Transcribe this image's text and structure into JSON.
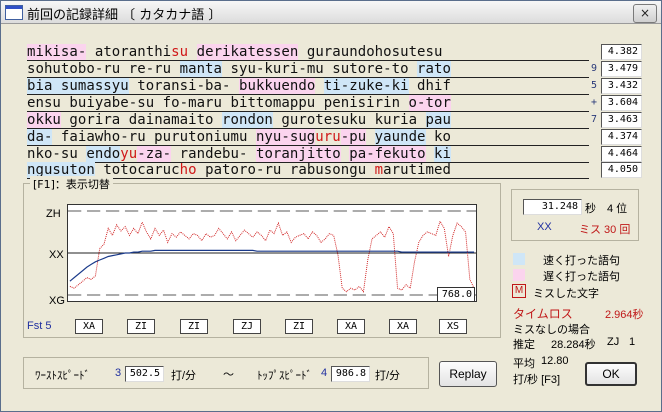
{
  "window": {
    "title": "前回の記録詳細 〔 カタカナ語 〕",
    "close_label": "×"
  },
  "text_lines": [
    {
      "mark": "",
      "speed": "4.382",
      "segments": [
        {
          "t": "mikisa-",
          "c": "slow"
        },
        {
          "t": " atoranthi",
          "c": ""
        },
        {
          "t": "su",
          "c": "miss"
        },
        {
          "t": " ",
          "c": ""
        },
        {
          "t": "derikatessen",
          "c": "slow"
        },
        {
          "t": " guraundohosutesu",
          "c": ""
        }
      ]
    },
    {
      "mark": "9",
      "speed": "3.479",
      "segments": [
        {
          "t": "sohutobo-ru re-ru ",
          "c": ""
        },
        {
          "t": "manta",
          "c": "fast"
        },
        {
          "t": " syu-kuri-mu sutore-to ",
          "c": ""
        },
        {
          "t": "rato",
          "c": "fast"
        }
      ]
    },
    {
      "mark": "5",
      "speed": "3.432",
      "segments": [
        {
          "t": "bia sumassyu",
          "c": "fast"
        },
        {
          "t": " toransi-ba- ",
          "c": ""
        },
        {
          "t": "bukkuendo",
          "c": "slow"
        },
        {
          "t": " ",
          "c": ""
        },
        {
          "t": "ti-zuke-ki",
          "c": "fast"
        },
        {
          "t": " dhif",
          "c": ""
        }
      ]
    },
    {
      "mark": "+",
      "speed": "3.604",
      "segments": [
        {
          "t": "ensu buiyabe-su fo-maru bittomappu penisirin ",
          "c": ""
        },
        {
          "t": "o-tor",
          "c": "slow"
        }
      ]
    },
    {
      "mark": "7",
      "speed": "3.463",
      "segments": [
        {
          "t": "okku",
          "c": "slow"
        },
        {
          "t": " gorira dainamaito ",
          "c": ""
        },
        {
          "t": "rondon",
          "c": "fast"
        },
        {
          "t": " gurotesuku kuria ",
          "c": ""
        },
        {
          "t": "pau",
          "c": "fast"
        }
      ]
    },
    {
      "mark": "",
      "speed": "4.374",
      "segments": [
        {
          "t": "da-",
          "c": "fast"
        },
        {
          "t": " faiawho-ru purutoniumu ",
          "c": ""
        },
        {
          "t": "nyu-sug",
          "c": "slow"
        },
        {
          "t": "uru",
          "c": "miss"
        },
        {
          "t": "-pu",
          "c": "slow"
        },
        {
          "t": " ",
          "c": ""
        },
        {
          "t": "yaunde",
          "c": "fast"
        },
        {
          "t": " ko",
          "c": ""
        }
      ]
    },
    {
      "mark": "",
      "speed": "4.464",
      "segments": [
        {
          "t": "nko-su ",
          "c": ""
        },
        {
          "t": "endo",
          "c": "fast"
        },
        {
          "t": "yu",
          "c": "miss"
        },
        {
          "t": "-za-",
          "c": "slow"
        },
        {
          "t": " randebu- ",
          "c": ""
        },
        {
          "t": "toranjitto",
          "c": "slow"
        },
        {
          "t": " ",
          "c": ""
        },
        {
          "t": "pa-fekuto",
          "c": "slow"
        },
        {
          "t": " ",
          "c": ""
        },
        {
          "t": "ki",
          "c": "fast"
        }
      ]
    },
    {
      "mark": "",
      "speed": "4.050",
      "segments": [
        {
          "t": "ngusuton",
          "c": "fast"
        },
        {
          "t": " totocaruc",
          "c": ""
        },
        {
          "t": "ho",
          "c": "miss"
        },
        {
          "t": " patoro-ru rabusongu ",
          "c": ""
        },
        {
          "t": "m",
          "c": "miss"
        },
        {
          "t": "arutimed",
          "c": ""
        }
      ]
    }
  ],
  "graph": {
    "group_label": "[F1]：表示切替",
    "y_top": "ZH",
    "y_mid": "XX",
    "y_bottom": "XG",
    "readout": "768.0",
    "fst_label": "Fst 5",
    "x_categories": [
      "XA",
      "ZI",
      "ZI",
      "ZJ",
      "ZI",
      "XA",
      "XA",
      "XS"
    ]
  },
  "chart_data": {
    "type": "line",
    "title": "",
    "y_tick_labels": [
      "ZH",
      "XX",
      "XG"
    ],
    "x_tick_labels": [
      "XA",
      "ZI",
      "ZI",
      "ZJ",
      "ZI",
      "XA",
      "XA",
      "XS"
    ],
    "series": [
      {
        "name": "",
        "color": "#d02020",
        "values": [
          0.12,
          0.1,
          0.14,
          0.18,
          0.22,
          0.2,
          0.24,
          0.55,
          0.6,
          0.78,
          0.7,
          0.82,
          0.75,
          0.8,
          0.7,
          0.78,
          0.72,
          0.85,
          0.74,
          0.66,
          0.78,
          0.7,
          0.76,
          0.62,
          0.72,
          0.68,
          0.74,
          0.7,
          0.66,
          0.72,
          0.7,
          0.64,
          0.72,
          0.68,
          0.7,
          0.78,
          0.72,
          0.66,
          0.74,
          0.64,
          0.7,
          0.76,
          0.72,
          0.68,
          0.74,
          0.7,
          0.64,
          0.76,
          0.72,
          0.84,
          0.7,
          0.74,
          0.62,
          0.68,
          0.7,
          0.72,
          0.66,
          0.74,
          0.7,
          0.62,
          0.66,
          0.72,
          0.7,
          0.48,
          0.1,
          0.06,
          0.1,
          0.08,
          0.12,
          0.06,
          0.42,
          0.66,
          0.7,
          0.74,
          0.68,
          0.8,
          0.72,
          0.1,
          0.08,
          0.14,
          0.1,
          0.4,
          0.62,
          0.7,
          0.74,
          0.72,
          0.7,
          0.86,
          0.78,
          0.46,
          0.7,
          0.84,
          0.8,
          0.74,
          0.2,
          0.1
        ]
      },
      {
        "name": "",
        "color": "#1a3a8a",
        "values": [
          0.18,
          0.22,
          0.26,
          0.3,
          0.34,
          0.37,
          0.4,
          0.42,
          0.44,
          0.46,
          0.47,
          0.48,
          0.49,
          0.5,
          0.5,
          0.51,
          0.51,
          0.52,
          0.52,
          0.52,
          0.53,
          0.53,
          0.53,
          0.53,
          0.53,
          0.53,
          0.53,
          0.53,
          0.53,
          0.53,
          0.53,
          0.53,
          0.53,
          0.53,
          0.53,
          0.53,
          0.53,
          0.53,
          0.53,
          0.53,
          0.53,
          0.53,
          0.53,
          0.53,
          0.52,
          0.52,
          0.52,
          0.52,
          0.52,
          0.52,
          0.52,
          0.52,
          0.52,
          0.52,
          0.52,
          0.52,
          0.52,
          0.52,
          0.52,
          0.52,
          0.52,
          0.52,
          0.52,
          0.52,
          0.52,
          0.52,
          0.52,
          0.52,
          0.52,
          0.52,
          0.52,
          0.52,
          0.52,
          0.52,
          0.52,
          0.52,
          0.52,
          0.52,
          0.51,
          0.51,
          0.51,
          0.51,
          0.51,
          0.51,
          0.51,
          0.51,
          0.51,
          0.51,
          0.51,
          0.51,
          0.51,
          0.51,
          0.51,
          0.51,
          0.51,
          0.51
        ]
      }
    ],
    "ylim": [
      0,
      1
    ]
  },
  "bottom": {
    "worst_label": "ﾜｰｽﾄｽﾋﾟｰﾄﾞ",
    "worst_idx": "3",
    "worst_value": "502.5",
    "worst_unit": "打/分",
    "tilde": "〜",
    "top_label": "ﾄｯﾌﾟｽﾋﾟｰﾄﾞ",
    "top_idx": "4",
    "top_value": "986.8",
    "top_unit": "打/分",
    "replay_label": "Replay"
  },
  "result": {
    "time_value": "31.248",
    "time_unit": "秒",
    "rank": "4 位",
    "grade": "XX",
    "miss": "ミス 30 回"
  },
  "legend": {
    "fast_label": "速く打った語句",
    "slow_label": "遅く打った語句",
    "miss_mark": "M",
    "miss_label": "ミスした文字",
    "fast_color": "#cfe6f7",
    "slow_color": "#fbd4ee"
  },
  "stats": {
    "timeloss_label": "タイムロス",
    "timeloss_value": "2.964秒",
    "nomiss_label": "ミスなしの場合",
    "estimate_label": "推定",
    "estimate_value": "28.284秒",
    "estimate_grade": "ZJ",
    "estimate_rank": "1",
    "avg_label": "平均",
    "avg_value": "12.80",
    "avg_unit": "打/秒 [F3]",
    "ok_label": "OK"
  }
}
